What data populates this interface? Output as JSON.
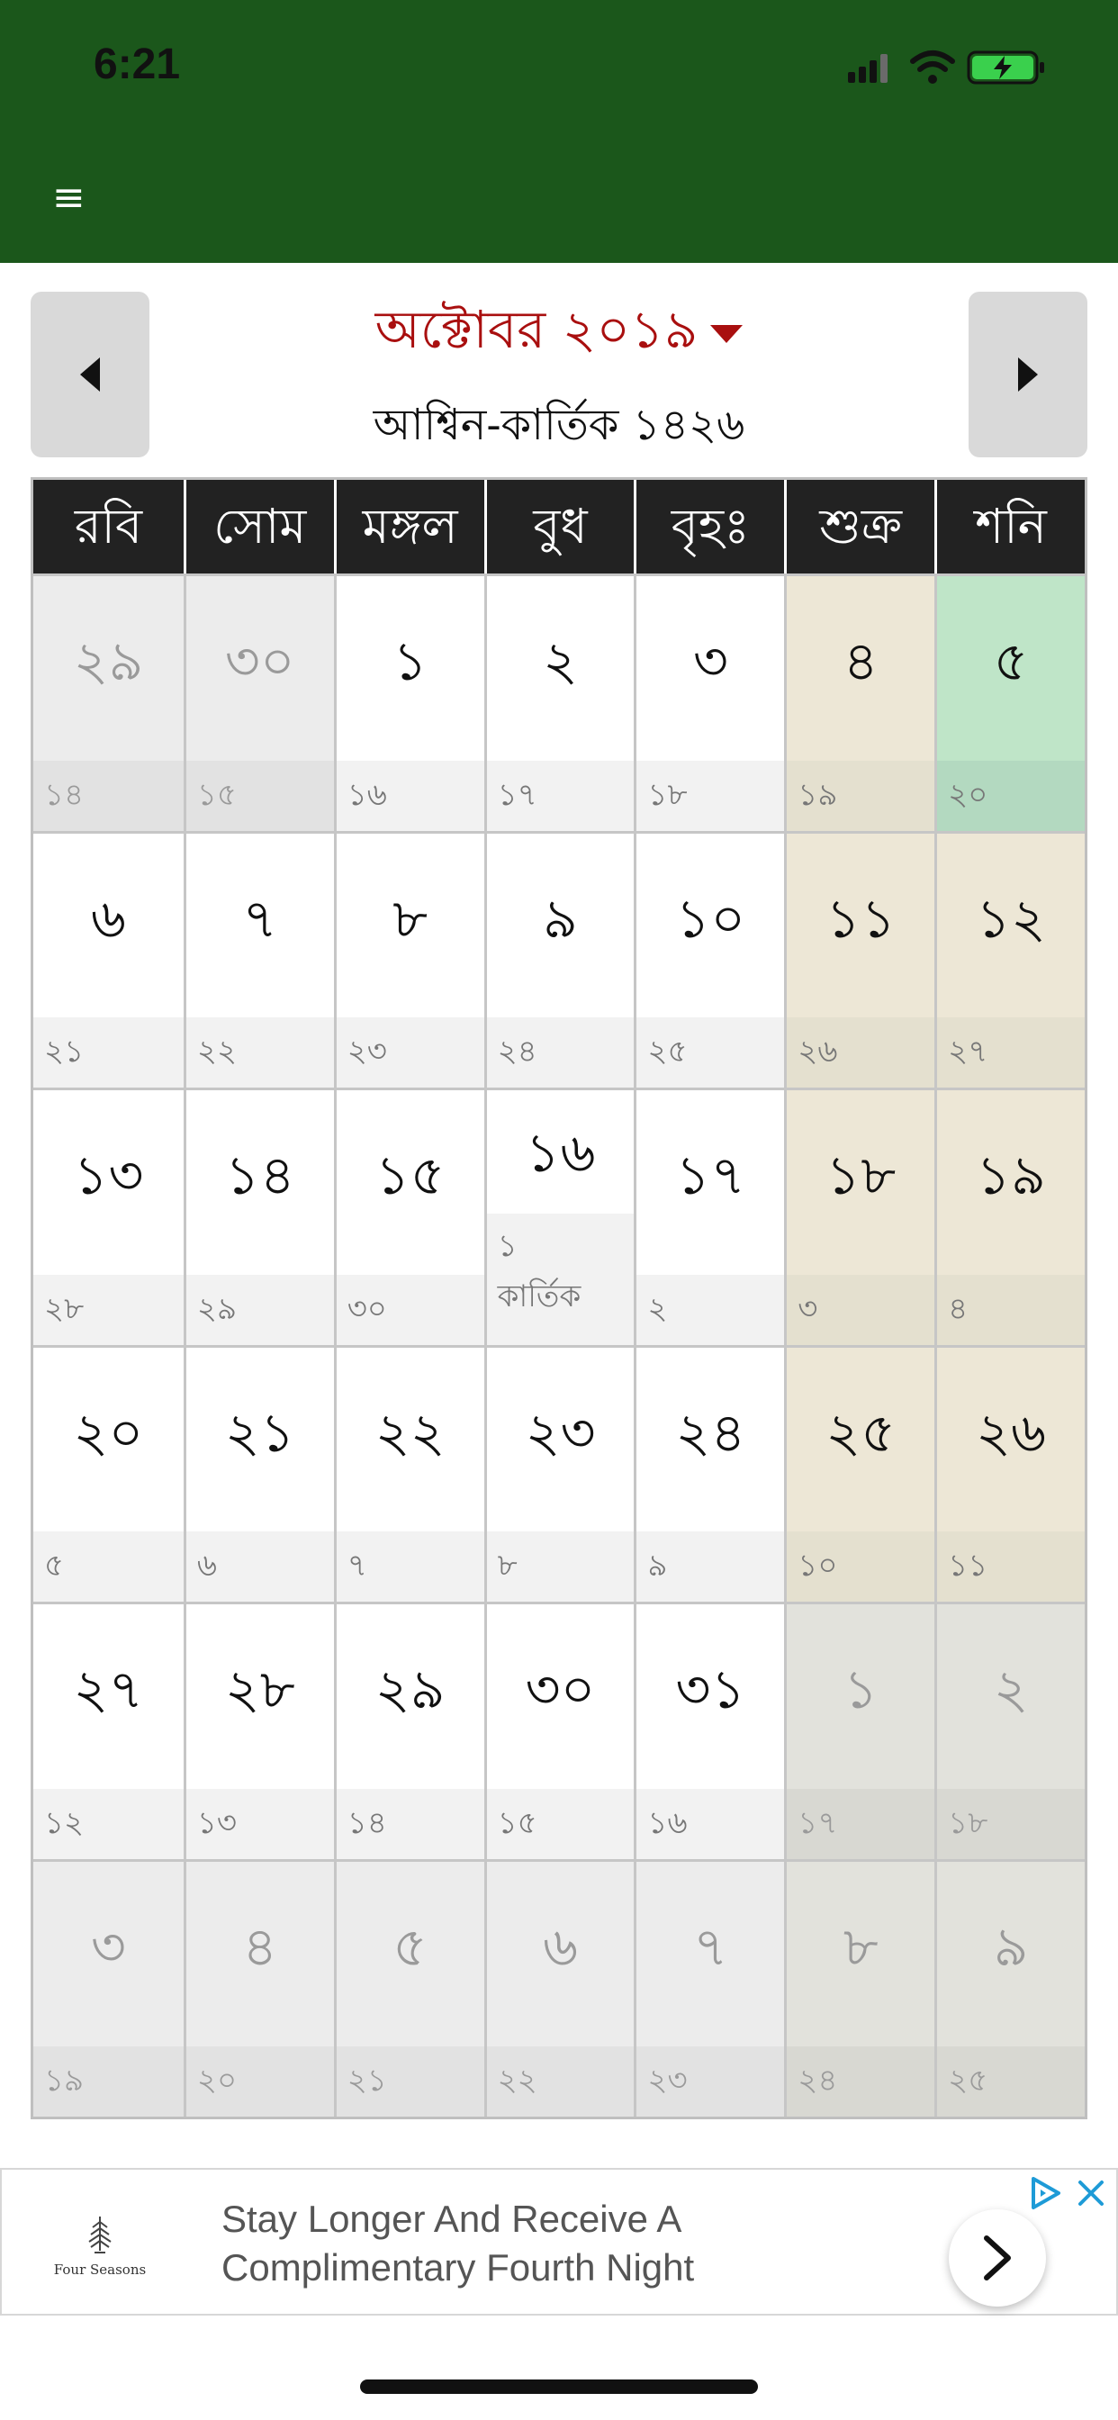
{
  "status_bar": {
    "time": "6:21",
    "icons": [
      "signal-icon",
      "wifi-icon",
      "battery-charging-icon"
    ]
  },
  "header": {
    "menu_icon": "hamburger-menu-icon",
    "background_color": "#1b571b"
  },
  "month_nav": {
    "title": "অক্টোবর ২০১৯",
    "subtitle": "আশ্বিন-কার্তিক ১৪২৬",
    "prev_icon": "triangle-left-icon",
    "next_icon": "triangle-right-icon",
    "dropdown_icon": "caret-down-icon",
    "title_color": "#a90f0f"
  },
  "weekdays": [
    "রবি",
    "সোম",
    "মঙ্গল",
    "বুধ",
    "বৃহঃ",
    "শুক্র",
    "শনি"
  ],
  "weeks": [
    [
      {
        "day": "২৯",
        "sub": "১৪",
        "type": "other"
      },
      {
        "day": "৩০",
        "sub": "১৫",
        "type": "other"
      },
      {
        "day": "১",
        "sub": "১৬",
        "type": "normal"
      },
      {
        "day": "২",
        "sub": "১৭",
        "type": "normal"
      },
      {
        "day": "৩",
        "sub": "১৮",
        "type": "normal"
      },
      {
        "day": "৪",
        "sub": "১৯",
        "type": "weekend"
      },
      {
        "day": "৫",
        "sub": "২০",
        "type": "today"
      }
    ],
    [
      {
        "day": "৬",
        "sub": "২১",
        "type": "normal"
      },
      {
        "day": "৭",
        "sub": "২২",
        "type": "normal"
      },
      {
        "day": "৮",
        "sub": "২৩",
        "type": "normal"
      },
      {
        "day": "৯",
        "sub": "২৪",
        "type": "normal"
      },
      {
        "day": "১০",
        "sub": "২৫",
        "type": "normal"
      },
      {
        "day": "১১",
        "sub": "২৬",
        "type": "weekend"
      },
      {
        "day": "১২",
        "sub": "২৭",
        "type": "weekend"
      }
    ],
    [
      {
        "day": "১৩",
        "sub": "২৮",
        "type": "normal"
      },
      {
        "day": "১৪",
        "sub": "২৯",
        "type": "normal"
      },
      {
        "day": "১৫",
        "sub": "৩০",
        "type": "normal"
      },
      {
        "day": "১৬",
        "sub": "১\nকার্তিক",
        "type": "normal",
        "split": true
      },
      {
        "day": "১৭",
        "sub": "২",
        "type": "normal"
      },
      {
        "day": "১৮",
        "sub": "৩",
        "type": "weekend"
      },
      {
        "day": "১৯",
        "sub": "৪",
        "type": "weekend"
      }
    ],
    [
      {
        "day": "২০",
        "sub": "৫",
        "type": "normal"
      },
      {
        "day": "২১",
        "sub": "৬",
        "type": "normal"
      },
      {
        "day": "২২",
        "sub": "৭",
        "type": "normal"
      },
      {
        "day": "২৩",
        "sub": "৮",
        "type": "normal"
      },
      {
        "day": "২৪",
        "sub": "৯",
        "type": "normal"
      },
      {
        "day": "২৫",
        "sub": "১০",
        "type": "weekend"
      },
      {
        "day": "২৬",
        "sub": "১১",
        "type": "weekend"
      }
    ],
    [
      {
        "day": "২৭",
        "sub": "১২",
        "type": "normal"
      },
      {
        "day": "২৮",
        "sub": "১৩",
        "type": "normal"
      },
      {
        "day": "২৯",
        "sub": "১৪",
        "type": "normal"
      },
      {
        "day": "৩০",
        "sub": "১৫",
        "type": "normal"
      },
      {
        "day": "৩১",
        "sub": "১৬",
        "type": "normal"
      },
      {
        "day": "১",
        "sub": "১৭",
        "type": "other-weekend"
      },
      {
        "day": "২",
        "sub": "১৮",
        "type": "other-weekend"
      }
    ],
    [
      {
        "day": "৩",
        "sub": "১৯",
        "type": "other"
      },
      {
        "day": "৪",
        "sub": "২০",
        "type": "other"
      },
      {
        "day": "৫",
        "sub": "২১",
        "type": "other"
      },
      {
        "day": "৬",
        "sub": "২২",
        "type": "other"
      },
      {
        "day": "৭",
        "sub": "২৩",
        "type": "other"
      },
      {
        "day": "৮",
        "sub": "২৪",
        "type": "other-weekend"
      },
      {
        "day": "৯",
        "sub": "২৫",
        "type": "other-weekend"
      }
    ]
  ],
  "ad": {
    "brand": "Four Seasons",
    "text_line1": "Stay Longer And Receive A",
    "text_line2": "Complimentary Fourth Night",
    "arrow_icon": "chevron-right-icon",
    "choices_icon": "ad-choices-icon",
    "close_icon": "close-icon",
    "accent_color": "#1e9bd7"
  }
}
